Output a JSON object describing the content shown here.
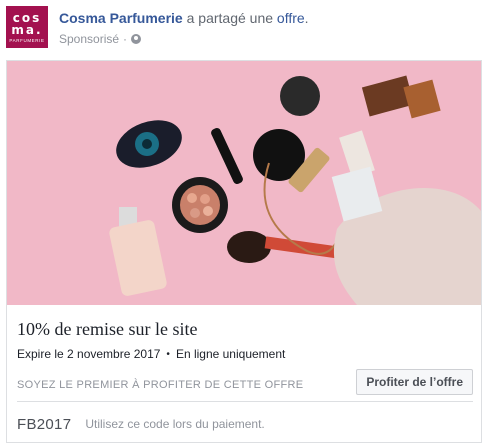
{
  "header": {
    "logo": {
      "line1": "cos",
      "line2": "ma.",
      "line3": "PARFUMERIE"
    },
    "page_name": "Cosma Parfumerie",
    "action_text": "a partagé une",
    "action_link": "offre",
    "punctuation": ".",
    "sponsored": "Sponsorisé",
    "separator": "·",
    "privacy_icon": "globe-icon"
  },
  "hero_image": {
    "description_icon": "cosmetics-photo",
    "background_color": "#f1b7c6"
  },
  "offer": {
    "title": "10% de remise sur le site",
    "expires": "Expire le 2 novembre 2017",
    "bullet": "•",
    "availability": "En ligne uniquement",
    "cta_prompt": "SOYEZ LE PREMIER À PROFITER DE CETTE OFFRE",
    "cta_button": "Profiter de l’offre",
    "code": "FB2017",
    "code_hint": "Utilisez ce code lors du paiement."
  },
  "colors": {
    "brand": "#a3114f",
    "link": "#365899",
    "muted": "#90949c"
  }
}
